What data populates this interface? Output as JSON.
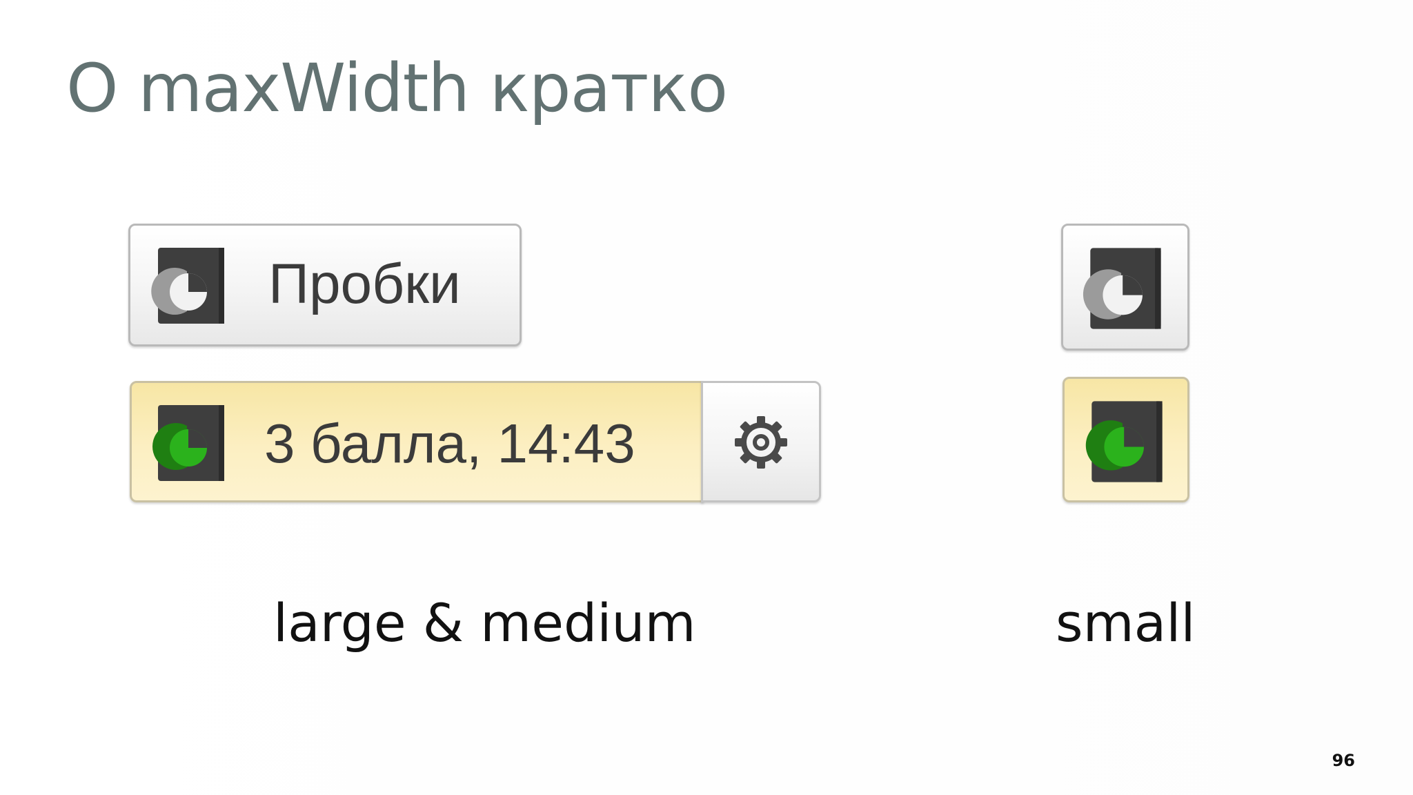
{
  "slide": {
    "title": "О maxWidth кратко",
    "page_number": "96"
  },
  "large_medium": {
    "traffic_button_label": "Пробки",
    "traffic_button_icon": "traffic-light-gray-icon",
    "status_label": "3 балла, 14:43",
    "status_icon": "traffic-light-green-icon",
    "settings_icon": "gear-icon",
    "caption": "large & medium"
  },
  "small": {
    "traffic_button_icon": "traffic-light-gray-icon",
    "status_icon": "traffic-light-green-icon",
    "caption": "small"
  },
  "colors": {
    "title": "#627272",
    "status_bg": "#fcefc2",
    "traffic_green": "#1f9a12",
    "icon_dark": "#3e3e3e"
  }
}
